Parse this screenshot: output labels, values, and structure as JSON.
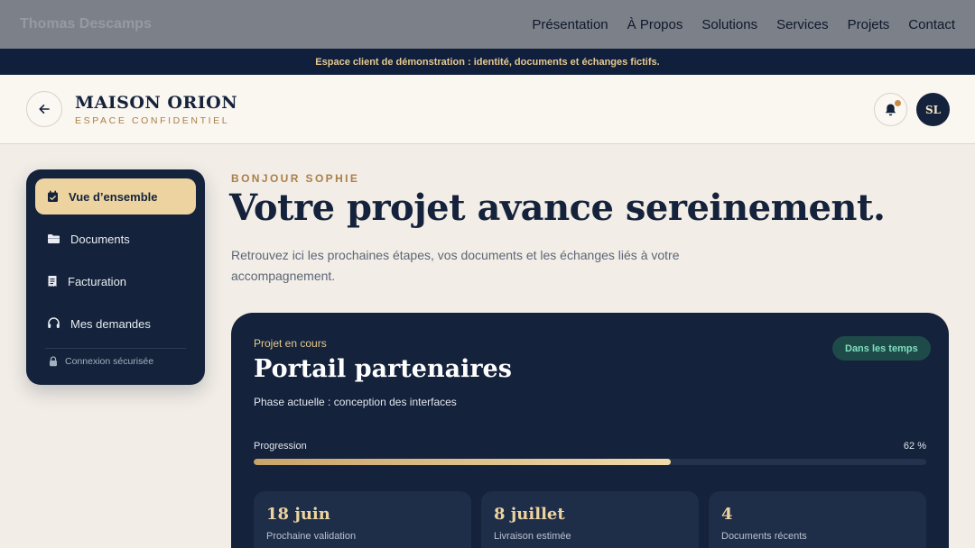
{
  "topnav": {
    "brand": "Thomas Descamps",
    "links": [
      "Présentation",
      "À Propos",
      "Solutions",
      "Services",
      "Projets",
      "Contact"
    ]
  },
  "banner": "Espace client de démonstration : identité, documents et échanges fictifs.",
  "header": {
    "name": "MAISON ORION",
    "subtitle": "ESPACE CONFIDENTIEL",
    "avatar_initials": "SL",
    "notification_dot_color": "#c98b4a"
  },
  "sidebar": {
    "items": [
      {
        "label": "Vue d’ensemble",
        "icon": "calendar-check-icon",
        "active": true
      },
      {
        "label": "Documents",
        "icon": "folder-icon",
        "active": false
      },
      {
        "label": "Facturation",
        "icon": "invoice-icon",
        "active": false
      },
      {
        "label": "Mes demandes",
        "icon": "headset-icon",
        "active": false
      }
    ],
    "secure_label": "Connexion sécurisée"
  },
  "main": {
    "greeting": "BONJOUR SOPHIE",
    "title": "Votre projet avance sereinement.",
    "intro": "Retrouvez ici les prochaines étapes, vos documents et les échanges liés à votre accompagnement."
  },
  "project": {
    "label": "Projet en cours",
    "title": "Portail partenaires",
    "phase": "Phase actuelle : conception des interfaces",
    "status": "Dans les temps",
    "progress_label": "Progression",
    "progress_text": "62 %",
    "progress_fraction": 0.62,
    "stats": [
      {
        "value": "18 juin",
        "label": "Prochaine validation"
      },
      {
        "value": "8 juillet",
        "label": "Livraison estimée"
      },
      {
        "value": "4",
        "label": "Documents récents"
      }
    ]
  },
  "colors": {
    "navy": "#14223b",
    "gold": "#ecd3a0",
    "accent_text": "#a98049",
    "status_bg": "#1f4a4a",
    "status_text": "#7fe0bf",
    "background": "#f2ede6"
  }
}
